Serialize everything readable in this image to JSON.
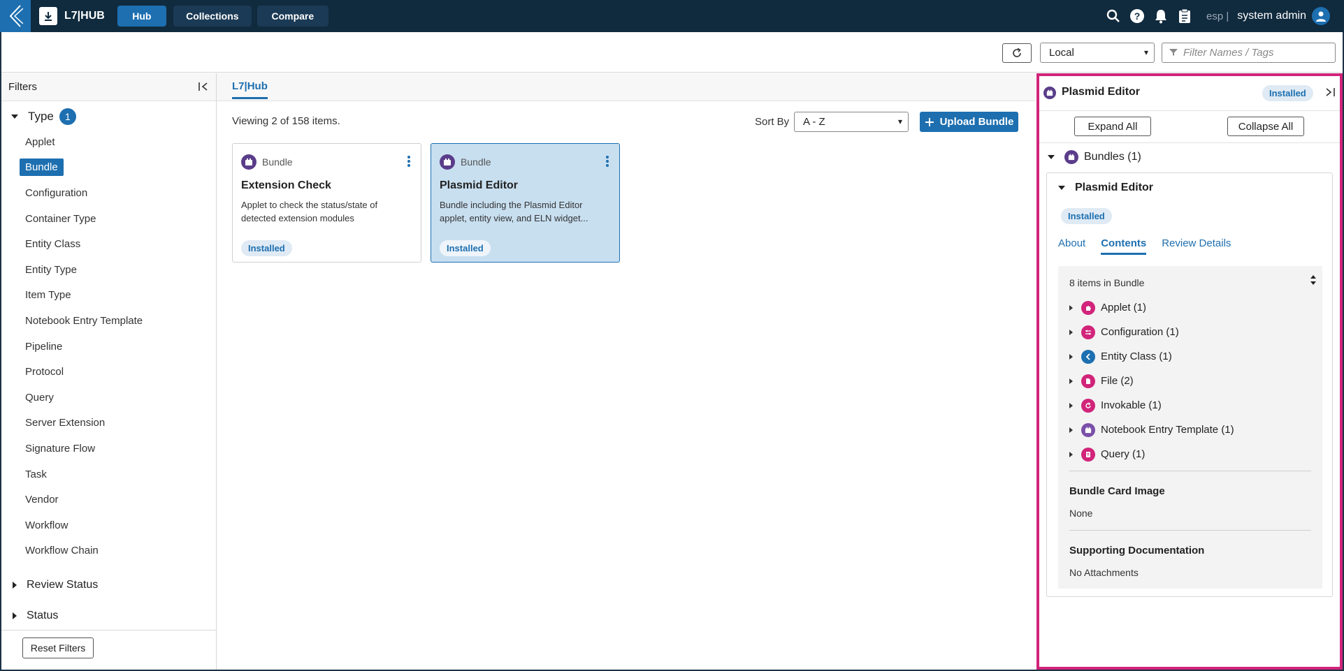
{
  "topbar": {
    "app_name": "L7|HUB",
    "nav": [
      "Hub",
      "Collections",
      "Compare"
    ],
    "lang": "esp |",
    "user": "system admin"
  },
  "toolbar": {
    "source_select": "Local",
    "filter_placeholder": "Filter Names / Tags"
  },
  "filters": {
    "title": "Filters",
    "type_label": "Type",
    "type_count": "1",
    "types": [
      "Applet",
      "Bundle",
      "Configuration",
      "Container Type",
      "Entity Class",
      "Entity Type",
      "Item Type",
      "Notebook Entry Template",
      "Pipeline",
      "Protocol",
      "Query",
      "Server Extension",
      "Signature Flow",
      "Task",
      "Vendor",
      "Workflow",
      "Workflow Chain"
    ],
    "selected_type": "Bundle",
    "review_status": "Review Status",
    "status": "Status",
    "reset": "Reset Filters"
  },
  "main": {
    "tab": "L7|Hub",
    "viewing": "Viewing 2 of 158 items.",
    "sort_label": "Sort By",
    "sort_value": "A - Z",
    "upload": "Upload Bundle",
    "cards": [
      {
        "type": "Bundle",
        "title": "Extension Check",
        "desc": "Applet to check the status/state of detected extension modules",
        "status": "Installed"
      },
      {
        "type": "Bundle",
        "title": "Plasmid Editor",
        "desc": "Bundle including the Plasmid Editor applet, entity view, and ELN widget...",
        "status": "Installed"
      }
    ]
  },
  "panel": {
    "title": "Plasmid Editor",
    "status": "Installed",
    "expand_all": "Expand All",
    "collapse_all": "Collapse All",
    "bundles_label": "Bundles (1)",
    "bundle_title": "Plasmid Editor",
    "bundle_status": "Installed",
    "tabs": [
      "About",
      "Contents",
      "Review Details"
    ],
    "items_count": "8 items in Bundle",
    "items": [
      {
        "label": "Applet (1)",
        "color": "#d1247a",
        "icon": "puzzle-icon"
      },
      {
        "label": "Configuration (1)",
        "color": "#d1247a",
        "icon": "sliders-icon"
      },
      {
        "label": "Entity Class (1)",
        "color": "#1d6fb0",
        "icon": "chevron-left-icon"
      },
      {
        "label": "File (2)",
        "color": "#d1247a",
        "icon": "file-icon"
      },
      {
        "label": "Invokable (1)",
        "color": "#d1247a",
        "icon": "refresh-icon"
      },
      {
        "label": "Notebook Entry Template (1)",
        "color": "#7a4fa8",
        "icon": "notebook-icon"
      },
      {
        "label": "Query (1)",
        "color": "#d1247a",
        "icon": "query-icon"
      }
    ],
    "card_image_label": "Bundle Card Image",
    "card_image_value": "None",
    "docs_label": "Supporting Documentation",
    "docs_value": "No Attachments"
  }
}
